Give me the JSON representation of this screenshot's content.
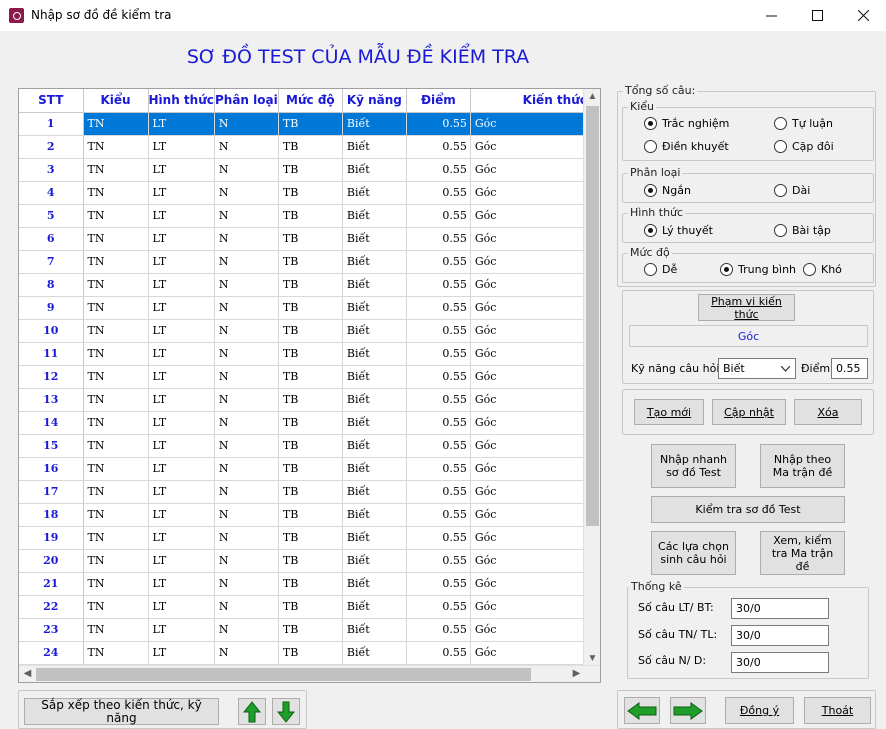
{
  "window": {
    "title": "Nhập sơ đồ đề kiểm tra"
  },
  "heading": "SƠ ĐỒ TEST CỦA MẪU ĐỀ KIỂM TRA",
  "grid": {
    "columns": [
      "STT",
      "Kiểu",
      "Hình thức",
      "Phân loại",
      "Mức độ",
      "Kỹ năng",
      "Điểm",
      "Kiến thức"
    ],
    "rows": [
      [
        "1",
        "TN",
        "LT",
        "N",
        "TB",
        "Biết",
        "0.55",
        "Góc"
      ],
      [
        "2",
        "TN",
        "LT",
        "N",
        "TB",
        "Biết",
        "0.55",
        "Góc"
      ],
      [
        "3",
        "TN",
        "LT",
        "N",
        "TB",
        "Biết",
        "0.55",
        "Góc"
      ],
      [
        "4",
        "TN",
        "LT",
        "N",
        "TB",
        "Biết",
        "0.55",
        "Góc"
      ],
      [
        "5",
        "TN",
        "LT",
        "N",
        "TB",
        "Biết",
        "0.55",
        "Góc"
      ],
      [
        "6",
        "TN",
        "LT",
        "N",
        "TB",
        "Biết",
        "0.55",
        "Góc"
      ],
      [
        "7",
        "TN",
        "LT",
        "N",
        "TB",
        "Biết",
        "0.55",
        "Góc"
      ],
      [
        "8",
        "TN",
        "LT",
        "N",
        "TB",
        "Biết",
        "0.55",
        "Góc"
      ],
      [
        "9",
        "TN",
        "LT",
        "N",
        "TB",
        "Biết",
        "0.55",
        "Góc"
      ],
      [
        "10",
        "TN",
        "LT",
        "N",
        "TB",
        "Biết",
        "0.55",
        "Góc"
      ],
      [
        "11",
        "TN",
        "LT",
        "N",
        "TB",
        "Biết",
        "0.55",
        "Góc"
      ],
      [
        "12",
        "TN",
        "LT",
        "N",
        "TB",
        "Biết",
        "0.55",
        "Góc"
      ],
      [
        "13",
        "TN",
        "LT",
        "N",
        "TB",
        "Biết",
        "0.55",
        "Góc"
      ],
      [
        "14",
        "TN",
        "LT",
        "N",
        "TB",
        "Biết",
        "0.55",
        "Góc"
      ],
      [
        "15",
        "TN",
        "LT",
        "N",
        "TB",
        "Biết",
        "0.55",
        "Góc"
      ],
      [
        "16",
        "TN",
        "LT",
        "N",
        "TB",
        "Biết",
        "0.55",
        "Góc"
      ],
      [
        "17",
        "TN",
        "LT",
        "N",
        "TB",
        "Biết",
        "0.55",
        "Góc"
      ],
      [
        "18",
        "TN",
        "LT",
        "N",
        "TB",
        "Biết",
        "0.55",
        "Góc"
      ],
      [
        "19",
        "TN",
        "LT",
        "N",
        "TB",
        "Biết",
        "0.55",
        "Góc"
      ],
      [
        "20",
        "TN",
        "LT",
        "N",
        "TB",
        "Biết",
        "0.55",
        "Góc"
      ],
      [
        "21",
        "TN",
        "LT",
        "N",
        "TB",
        "Biết",
        "0.55",
        "Góc"
      ],
      [
        "22",
        "TN",
        "LT",
        "N",
        "TB",
        "Biết",
        "0.55",
        "Góc"
      ],
      [
        "23",
        "TN",
        "LT",
        "N",
        "TB",
        "Biết",
        "0.55",
        "Góc"
      ],
      [
        "24",
        "TN",
        "LT",
        "N",
        "TB",
        "Biết",
        "0.55",
        "Góc"
      ]
    ],
    "selected_row": 0
  },
  "panel": {
    "group_title": "Tổng số câu:",
    "kieu": {
      "legend": "Kiểu",
      "options": [
        "Trắc nghiệm",
        "Tự luận",
        "Điền khuyết",
        "Cặp đôi"
      ],
      "selected": "Trắc nghiệm"
    },
    "phan_loai": {
      "legend": "Phân loại",
      "options": [
        "Ngắn",
        "Dài"
      ],
      "selected": "Ngắn"
    },
    "hinh_thuc": {
      "legend": "Hình thức",
      "options": [
        "Lý thuyết",
        "Bài tập"
      ],
      "selected": "Lý thuyết"
    },
    "muc_do": {
      "legend": "Mức độ",
      "options": [
        "Dễ",
        "Trung bình",
        "Khó"
      ],
      "selected": "Trung bình"
    },
    "pham_vi_button": "Phạm vi kiến thức",
    "kien_thuc_value": "Góc",
    "ky_nang_label": "Kỹ năng câu hỏi:",
    "ky_nang_value": "Biết",
    "diem_label": "Điểm:",
    "diem_value": "0.55",
    "btn_tao_moi": "Tạo mới",
    "btn_cap_nhat": "Cập nhật",
    "btn_xoa": "Xóa",
    "btn_nhap_nhanh": "Nhập nhanh sơ đồ Test",
    "btn_nhap_ma_tran": "Nhập theo Ma trận đề",
    "btn_kiem_tra": "Kiểm tra sơ đồ Test",
    "btn_cac_lua_chon": "Các lựa chọn sinh câu hỏi",
    "btn_xem_ma_tran": "Xem, kiểm tra Ma trận đề",
    "thong_ke": {
      "legend": "Thống kê",
      "lt_bt_label": "Số câu LT/ BT:",
      "lt_bt_value": "30/0",
      "tn_tl_label": "Số câu TN/ TL:",
      "tn_tl_value": "30/0",
      "n_d_label": "Số câu N/ D:",
      "n_d_value": "30/0"
    }
  },
  "footer": {
    "sort_button": "Sắp xếp theo kiến thức, kỹ năng",
    "btn_dong_y": "Đồng ý",
    "btn_thoat": "Thoát"
  },
  "colors": {
    "heading": "#1a1ad6",
    "selection": "#0078d7",
    "arrow_green": "#1f9e2a"
  }
}
